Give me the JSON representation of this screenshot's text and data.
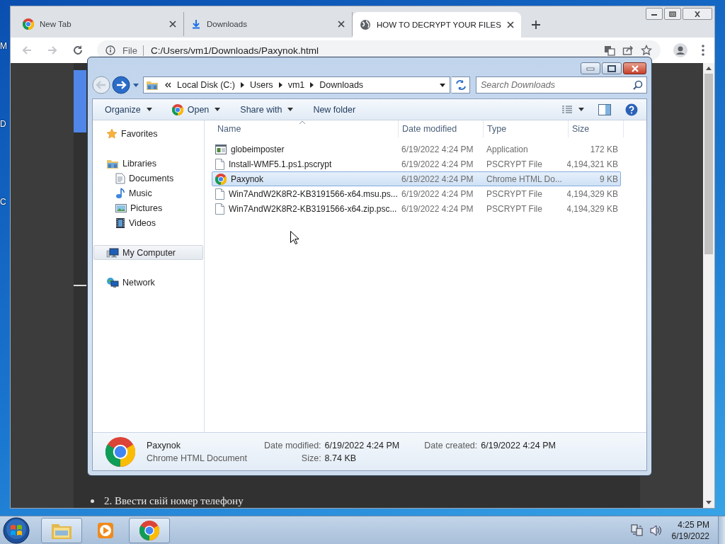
{
  "desktop": {
    "icon_labels": [
      "M",
      "D",
      "C"
    ]
  },
  "browser": {
    "tabs": [
      {
        "title": "New Tab",
        "kind": "chrome",
        "selected": false
      },
      {
        "title": "Downloads",
        "kind": "download",
        "selected": false
      },
      {
        "title": "HOW TO DECRYPT YOUR FILES",
        "kind": "globe",
        "selected": true
      }
    ],
    "nav_buttons": [
      {
        "kind": "back",
        "disabled": true
      },
      {
        "kind": "forward",
        "disabled": true
      },
      {
        "kind": "reload",
        "disabled": false
      }
    ],
    "address": {
      "scheme": "File",
      "url": "C:/Users/vm1/Downloads/Paxynok.html"
    },
    "page": {
      "list_item": "2. Ввести свій номер телефону"
    }
  },
  "explorer": {
    "breadcrumb": [
      "Local Disk (C:)",
      "Users",
      "vm1",
      "Downloads"
    ],
    "search": {
      "placeholder": "Search Downloads"
    },
    "toolbar": [
      {
        "label": "Organize",
        "kind": "menu"
      },
      {
        "label": "Open",
        "kind": "appmenu"
      },
      {
        "label": "Share with",
        "kind": "menu"
      },
      {
        "label": "New folder",
        "kind": "button"
      }
    ],
    "nav_pane": [
      {
        "label": "Favorites",
        "kind": "star",
        "selected": false
      },
      {
        "label": "Libraries",
        "kind": "library",
        "selected": false,
        "children": [
          {
            "label": "Documents",
            "kind": "document",
            "selected": false
          },
          {
            "label": "Music",
            "kind": "music",
            "selected": false
          },
          {
            "label": "Pictures",
            "kind": "picture",
            "selected": false
          },
          {
            "label": "Videos",
            "kind": "video",
            "selected": false
          }
        ]
      },
      {
        "label": "My Computer",
        "kind": "computer",
        "selected": true
      },
      {
        "label": "Network",
        "kind": "network",
        "selected": false
      }
    ],
    "columns": [
      "Name",
      "Date modified",
      "Type",
      "Size"
    ],
    "files": [
      {
        "name": "globeimposter",
        "date": "6/19/2022 4:24 PM",
        "type": "Application",
        "size": "172 KB",
        "kind": "app",
        "selected": false
      },
      {
        "name": "Install-WMF5.1.ps1.pscrypt",
        "date": "6/19/2022 4:24 PM",
        "type": "PSCRYPT File",
        "size": "4,194,321 KB",
        "kind": "blank",
        "selected": false
      },
      {
        "name": "Paxynok",
        "date": "6/19/2022 4:24 PM",
        "type": "Chrome HTML Do...",
        "size": "9 KB",
        "kind": "chrome",
        "selected": true
      },
      {
        "name": "Win7AndW2K8R2-KB3191566-x64.msu.ps...",
        "date": "6/19/2022 4:24 PM",
        "type": "PSCRYPT File",
        "size": "4,194,329 KB",
        "kind": "blank",
        "selected": false
      },
      {
        "name": "Win7AndW2K8R2-KB3191566-x64.zip.psc...",
        "date": "6/19/2022 4:24 PM",
        "type": "PSCRYPT File",
        "size": "4,194,329 KB",
        "kind": "blank",
        "selected": false
      }
    ],
    "details": {
      "name": "Paxynok",
      "type": "Chrome HTML Document",
      "kind": "chrome",
      "fields": [
        {
          "label": "Date modified:",
          "value": "6/19/2022 4:24 PM"
        },
        {
          "label": "Date created:",
          "value": "6/19/2022 4:24 PM"
        },
        {
          "label": "Size:",
          "value": "8.74 KB"
        }
      ]
    }
  },
  "taskbar": {
    "apps": [
      {
        "kind": "explorer",
        "open": true
      },
      {
        "kind": "media",
        "open": false
      },
      {
        "kind": "chrome",
        "open": true
      }
    ],
    "time": "4:25 PM",
    "date": "6/19/2022"
  }
}
